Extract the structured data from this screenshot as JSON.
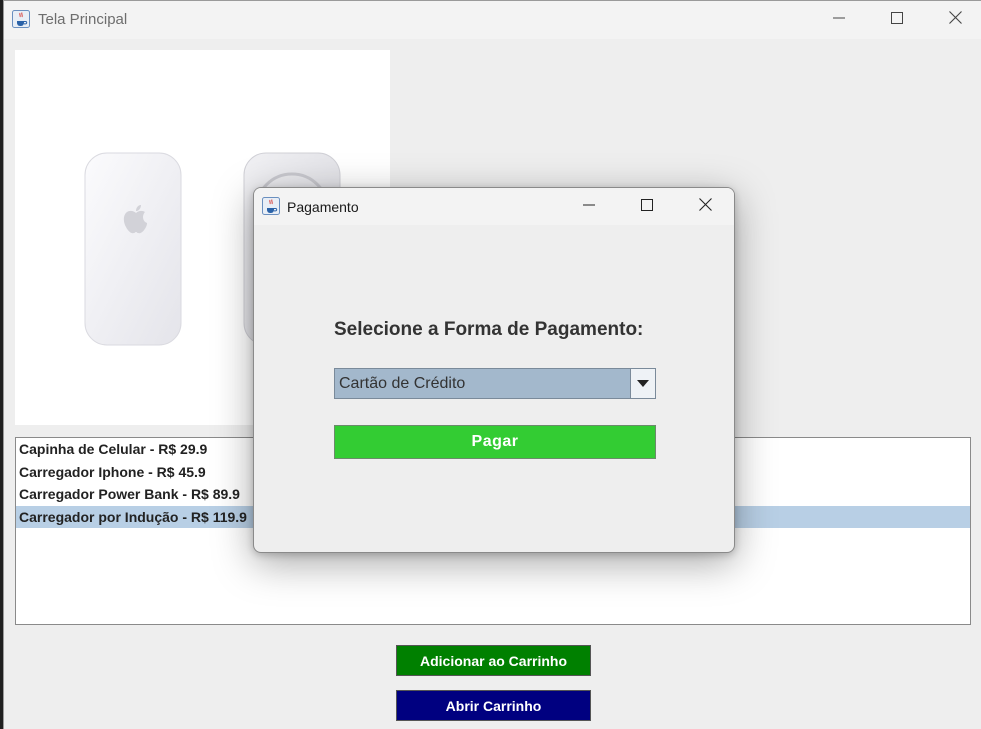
{
  "main_window": {
    "title": "Tela Principal",
    "icon": "java-coffee-icon"
  },
  "products": {
    "items": [
      {
        "label": "Capinha de Celular - R$ 29.9",
        "selected": false
      },
      {
        "label": "Carregador Iphone - R$ 45.9",
        "selected": false
      },
      {
        "label": "Carregador Power Bank - R$ 89.9",
        "selected": false
      },
      {
        "label": "Carregador por Indução - R$ 119.9",
        "selected": true
      }
    ],
    "selection_color": "#b8cfe5"
  },
  "buttons": {
    "add_to_cart": "Adicionar ao Carrinho",
    "open_cart": "Abrir Carrinho",
    "add_color": "#008000",
    "cart_color": "#000080"
  },
  "dialog": {
    "title": "Pagamento",
    "icon": "java-coffee-icon",
    "prompt": "Selecione a Forma de Pagamento:",
    "payment_method": {
      "selected": "Cartão de Crédito"
    },
    "pay_button": "Pagar",
    "pay_color": "#33cc33"
  }
}
